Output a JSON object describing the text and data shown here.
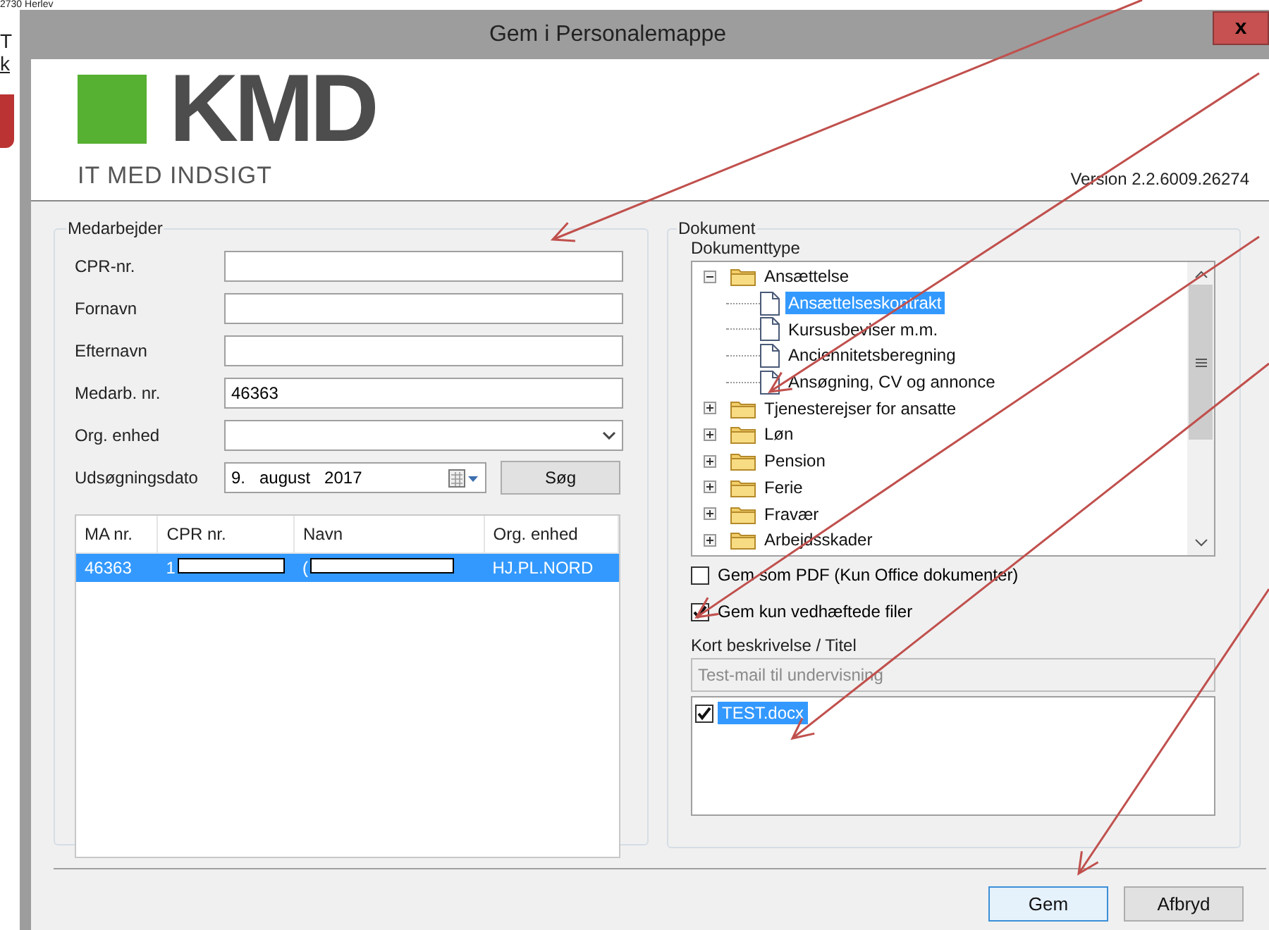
{
  "background_page": {
    "lines": [
      {
        "text": "2730 Herlev",
        "kind": "text"
      },
      {
        "text": "T",
        "kind": "text"
      },
      {
        "text": "k",
        "kind": "link"
      }
    ]
  },
  "window": {
    "title": "Gem i Personalemappe",
    "close": "x"
  },
  "header": {
    "logo_text": "KMD",
    "tagline": "IT MED INDSIGT",
    "version": "Version 2.2.6009.26274"
  },
  "employee": {
    "title": "Medarbejder",
    "fields": [
      {
        "label": "CPR-nr.",
        "kind": "text"
      },
      {
        "label": "Fornavn",
        "kind": "text"
      },
      {
        "label": "Efternavn",
        "kind": "text"
      },
      {
        "label": "Medarb. nr.",
        "kind": "text",
        "value": "46363"
      },
      {
        "label": "Org. enhed",
        "kind": "combo"
      },
      {
        "label": "Udsøgningsdato",
        "kind": "date",
        "value": "9.   august   2017"
      }
    ],
    "search_button": "Søg",
    "table": {
      "columns": [
        "MA nr.",
        "CPR nr.",
        "Navn",
        "Org. enhed"
      ],
      "rows": [
        {
          "selected": true,
          "cells": [
            {
              "text": "46363",
              "redacted": false
            },
            {
              "text": "1",
              "redacted": true
            },
            {
              "text": "(",
              "redacted": true
            },
            {
              "text": "HJ.PL.NORD",
              "redacted": false
            }
          ]
        }
      ]
    }
  },
  "document": {
    "title": "Dokument",
    "type_label": "Dokumenttype",
    "tree": [
      {
        "label": "Ansættelse",
        "expanded": true,
        "selected": false,
        "children": [
          {
            "label": "Ansættelseskontrakt",
            "selected": true
          },
          {
            "label": "Kursusbeviser m.m.",
            "selected": false
          },
          {
            "label": "Anciennitetsberegning",
            "selected": false
          },
          {
            "label": "Ansøgning, CV og annonce",
            "selected": false
          }
        ]
      },
      {
        "label": "Tjenesterejser for ansatte",
        "expanded": false,
        "selected": false
      },
      {
        "label": "Løn",
        "expanded": false,
        "selected": false
      },
      {
        "label": "Pension",
        "expanded": false,
        "selected": false
      },
      {
        "label": "Ferie",
        "expanded": false,
        "selected": false
      },
      {
        "label": "Fravær",
        "expanded": false,
        "selected": false
      },
      {
        "label": "Arbejdsskader",
        "expanded": false,
        "selected": false
      }
    ],
    "options": [
      {
        "label": "Gem som PDF (Kun Office dokumenter)",
        "checked": false
      },
      {
        "label": "Gem kun vedhæftede filer",
        "checked": true
      }
    ],
    "description": {
      "label": "Kort beskrivelse / Titel",
      "value": "Test-mail til undervisning",
      "disabled": true
    },
    "files": [
      {
        "name": "TEST.docx",
        "checked": true,
        "selected": true
      }
    ]
  },
  "buttons": [
    {
      "label": "Gem",
      "default": true
    },
    {
      "label": "Afbryd",
      "default": false
    }
  ]
}
